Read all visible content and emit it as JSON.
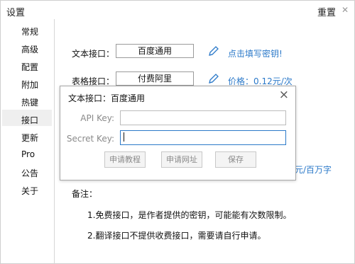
{
  "window": {
    "title": "设置",
    "reset_label": "重置",
    "close_glyph": "✕"
  },
  "sidebar": {
    "items": [
      {
        "label": "常规"
      },
      {
        "label": "高级"
      },
      {
        "label": "配置"
      },
      {
        "label": "附加"
      },
      {
        "label": "热键"
      },
      {
        "label": "接口"
      },
      {
        "label": "更新"
      },
      {
        "label": "Pro"
      },
      {
        "label": "公告"
      },
      {
        "label": "关于"
      }
    ],
    "selected": "接口"
  },
  "main": {
    "text_api": {
      "label": "文本接口：",
      "value": "百度通用",
      "link": "点击填写密钥!"
    },
    "table_api": {
      "label": "表格接口：",
      "value": "付费阿里",
      "price": "价格：0.12元/次"
    },
    "hidden_price_tail": "元/百万字",
    "notes": {
      "title": "备注：",
      "items": [
        "1.免费接口，是作者提供的密钥，可能能有次数限制。",
        "2.翻译接口不提供收费接口，需要请自行申请。"
      ]
    }
  },
  "dialog": {
    "title": "文本接口：百度通用",
    "api_key_label": "API Key:",
    "api_key_value": "",
    "secret_key_label": "Secret Key:",
    "secret_key_value": "",
    "buttons": {
      "tutorial": "申请教程",
      "url": "申请网址",
      "save": "保存"
    }
  },
  "colors": {
    "link": "#2b79c9",
    "pencil": "#2b79c9",
    "focus_border": "#2b79c9",
    "selected_bg": "#efefef"
  },
  "icons": {
    "edit": "pencil-icon",
    "close": "close-icon"
  }
}
